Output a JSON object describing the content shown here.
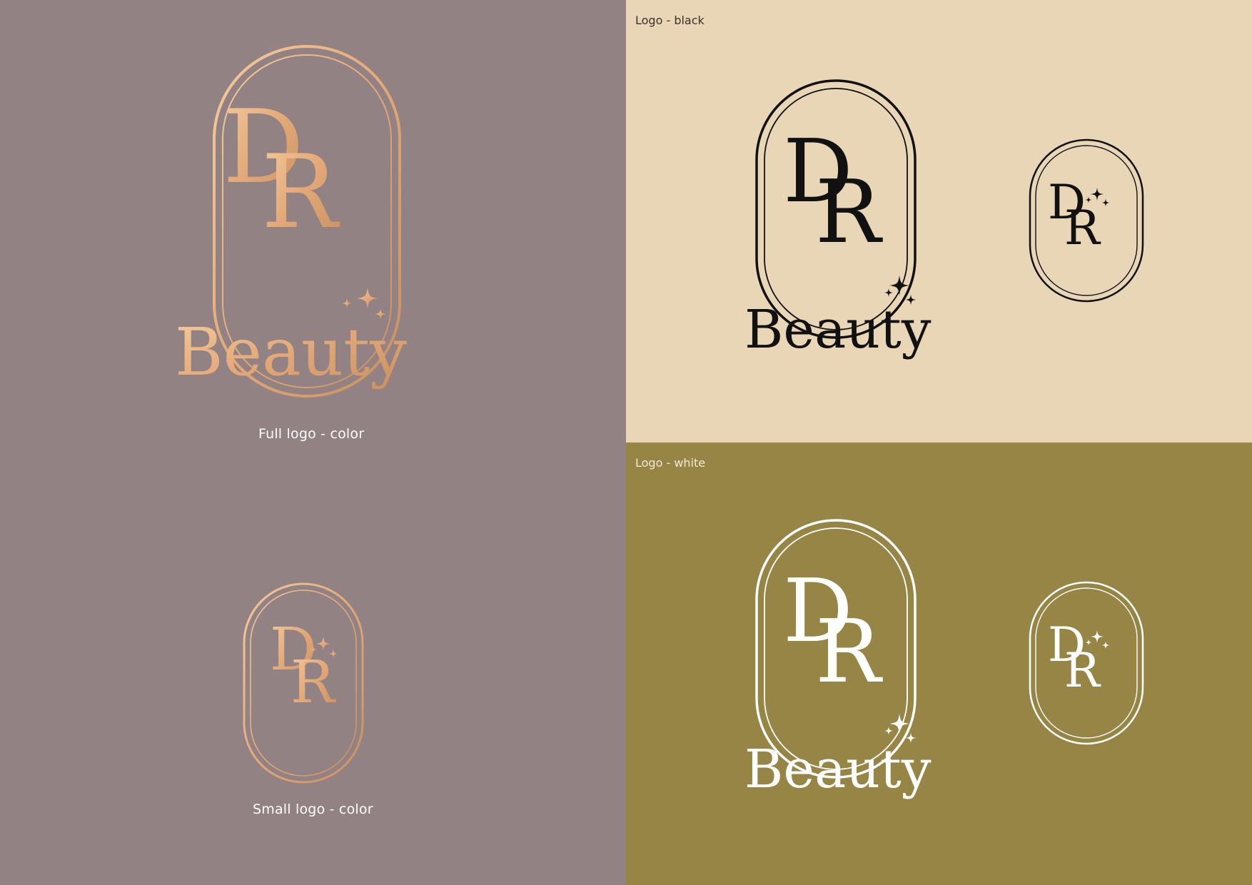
{
  "colors": {
    "panel_color_bg": "#928283",
    "panel_black_bg": "#e8d6b6",
    "panel_white_bg": "#968545",
    "gold_light": "#f2c898",
    "gold_dark": "#c98f5f",
    "black": "#111111",
    "white": "#ffffff"
  },
  "logo": {
    "monogram_first": "D",
    "monogram_second": "R",
    "wordmark": "Beauty",
    "sparkle_icon": "sparkles-icon",
    "frame_icon": "double-arch-frame"
  },
  "panels": {
    "color": {
      "full_caption": "Full logo - color",
      "small_caption": "Small logo - color"
    },
    "black": {
      "label": "Logo - black"
    },
    "white": {
      "label": "Logo - white"
    }
  }
}
